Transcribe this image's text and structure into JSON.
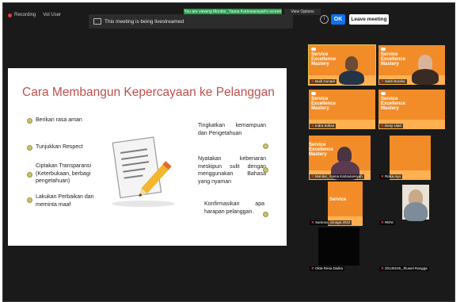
{
  "topbar": {
    "recording": "Recording",
    "recording2": "Vol User",
    "streaming_banner": "This meeting is being livestreamed",
    "viewing_label": "You are viewing Monitor_Yasna Kartoviansyah's screen",
    "view_options": "View Options",
    "ok": "OK",
    "leave": "Leave meeting"
  },
  "slide": {
    "title": "Cara Membangun Kepercayaan ke Pelanggan",
    "left_items": [
      "Berikan rasa aman",
      "Tunjukkan Respect",
      "Ciptakan Transparansi (Keterbukaan, berbagi pengetahuan)",
      "Lakukan Perbaikan dan meminta maaf"
    ],
    "right_items": [
      "Tingkatkan kemampuan dan Pengetahuan",
      "Nyatakan kebenaran meskipun sulit dengan menggunakan Bahasa yang nyaman",
      "Konfirmasikan apa harapan pelanggan."
    ]
  },
  "promo": {
    "line1": "Service",
    "line2": "Excellence",
    "line3": "Mastery"
  },
  "participants": [
    {
      "name": "Budi Gunadi"
    },
    {
      "name": "Sakti Baraka"
    },
    {
      "name": "Indra Sofian"
    },
    {
      "name": "Desy Utari"
    },
    {
      "name": "Monitor_Yasna Kartoviansyah"
    },
    {
      "name": "Riska Ayu"
    },
    {
      "name": "Santoso_Sinaga 2022"
    },
    {
      "name": "RENI"
    },
    {
      "name": "Okta Rena Dwika"
    },
    {
      "name": "20140245_Jhuwel Rangga"
    }
  ]
}
